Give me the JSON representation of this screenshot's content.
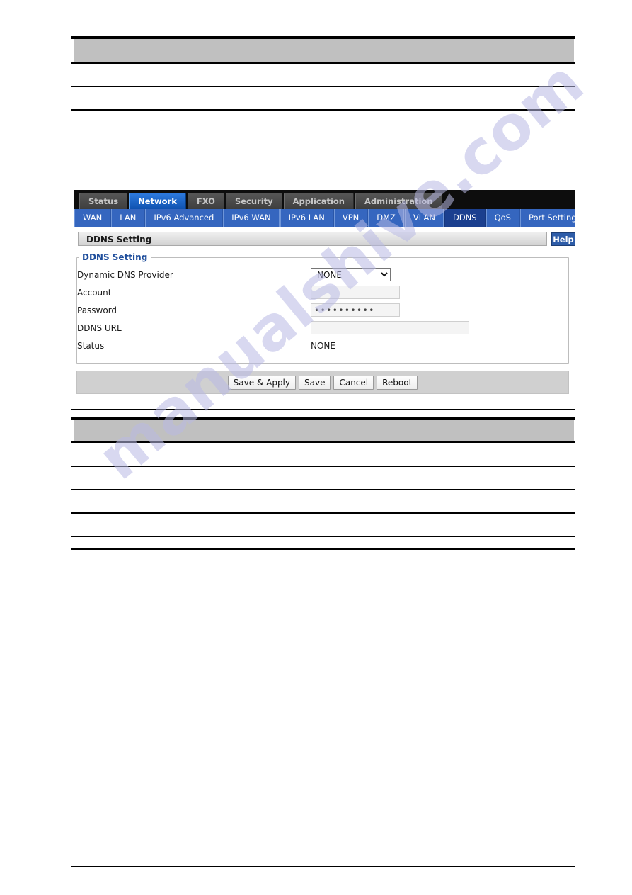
{
  "document": {
    "top_table": {
      "header_row_blank": "",
      "rows": [
        "",
        ""
      ]
    },
    "bottom_table": {
      "header_row_blank": "",
      "rows": [
        "",
        "",
        "",
        "",
        ""
      ]
    },
    "watermark": "manualshive.com"
  },
  "ui": {
    "main_tabs": [
      {
        "label": "Status",
        "active": false
      },
      {
        "label": "Network",
        "active": true
      },
      {
        "label": "FXO",
        "active": false
      },
      {
        "label": "Security",
        "active": false
      },
      {
        "label": "Application",
        "active": false
      },
      {
        "label": "Administration",
        "active": false
      }
    ],
    "sub_tabs": [
      {
        "label": "WAN",
        "active": false
      },
      {
        "label": "LAN",
        "active": false
      },
      {
        "label": "IPv6 Advanced",
        "active": false
      },
      {
        "label": "IPv6 WAN",
        "active": false
      },
      {
        "label": "IPv6 LAN",
        "active": false
      },
      {
        "label": "VPN",
        "active": false
      },
      {
        "label": "DMZ",
        "active": false
      },
      {
        "label": "VLAN",
        "active": false
      },
      {
        "label": "DDNS",
        "active": true
      },
      {
        "label": "QoS",
        "active": false
      },
      {
        "label": "Port Setting",
        "active": false
      }
    ],
    "page_title": "DDNS Setting",
    "help_button": "Help",
    "fieldset_legend": "DDNS Setting",
    "form": {
      "provider": {
        "label": "Dynamic DNS Provider",
        "value": "NONE",
        "options": [
          "NONE"
        ]
      },
      "account": {
        "label": "Account",
        "value": "",
        "placeholder": ""
      },
      "password": {
        "label": "Password",
        "value": "••••••••••",
        "placeholder": ""
      },
      "ddns_url": {
        "label": "DDNS URL",
        "value": "",
        "placeholder": ""
      },
      "status": {
        "label": "Status",
        "value": "NONE"
      }
    },
    "buttons": [
      {
        "label": "Save & Apply"
      },
      {
        "label": "Save"
      },
      {
        "label": "Cancel"
      },
      {
        "label": "Reboot"
      }
    ]
  },
  "colors": {
    "tab_active_blue": "#1a66c8",
    "subtab_blue": "#3566bf",
    "subtab_active_blue": "#1b3f8f",
    "legend_blue": "#1f4e9c",
    "band_gray": "#c0c0c0",
    "watermark": "#b9bae4"
  }
}
